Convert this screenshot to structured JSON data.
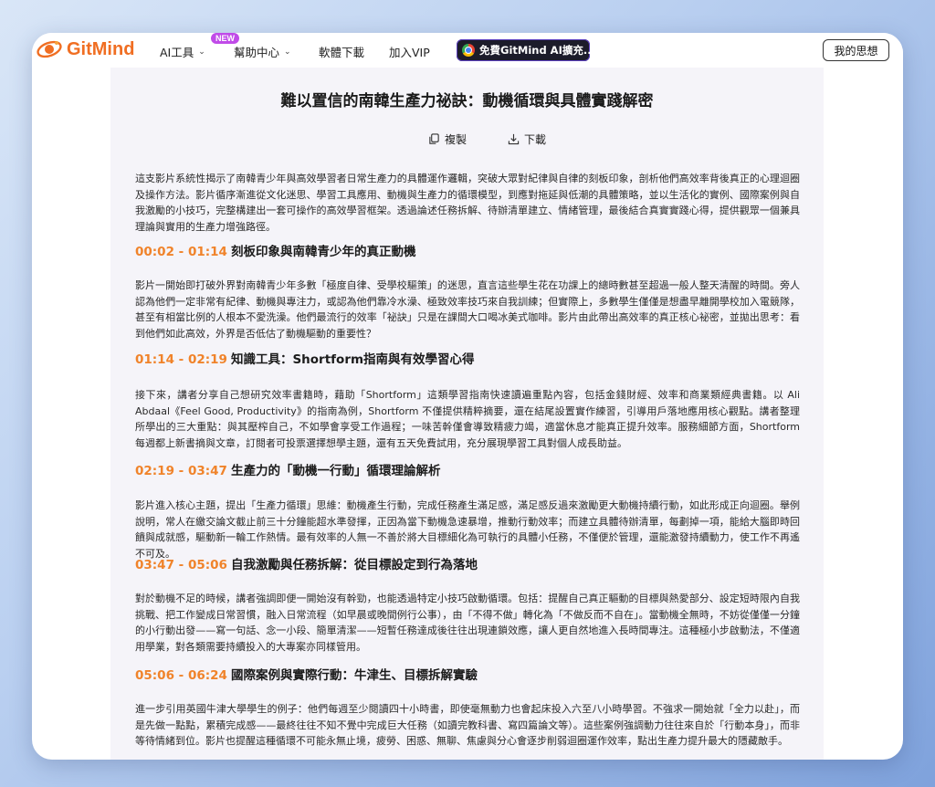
{
  "header": {
    "logo_text": "GitMind",
    "nav": [
      {
        "label": "AI工具"
      },
      {
        "label": "幫助中心"
      },
      {
        "label": "軟體下載"
      },
      {
        "label": "加入VIP"
      }
    ],
    "new_badge": "NEW",
    "promo_label": "免費GitMind AI擴充...",
    "my_ideas_label": "我的思想"
  },
  "article": {
    "title": "難以置信的南韓生產力祕訣：動機循環與具體實踐解密",
    "copy_label": "複製",
    "download_label": "下載",
    "intro": "這支影片系統性揭示了南韓青少年與高效學習者日常生產力的具體運作邏輯，突破大眾對紀律與自律的刻板印象，剖析他們高效率背後真正的心理迴圈及操作方法。影片循序漸進從文化迷思、學習工具應用、動機與生產力的循環模型，到應對拖延與低潮的具體策略，並以生活化的實例、國際案例與自我激勵的小技巧，完整構建出一套可操作的高效學習框架。透過論述任務拆解、待辦清單建立、情緒管理，最後結合真實實踐心得，提供觀眾一個兼具理論與實用的生產力增強路徑。",
    "sections": [
      {
        "time": "00:02 - 01:14",
        "heading": "刻板印象與南韓青少年的真正動機",
        "text": "影片一開始即打破外界對南韓青少年多數「極度自律、受學校驅策」的迷思，直言這些學生花在功課上的總時數甚至超過一般人整天清醒的時間。旁人認為他們一定非常有紀律、動機與專注力，或認為他們靠冷水澡、極致效率技巧來自我訓練；但實際上，多數學生僅僅是想盡早離開學校加入電競隊，甚至有相當比例的人根本不愛洗澡。他們最流行的效率「祕訣」只是在課間大口喝冰美式咖啡。影片由此帶出高效率的真正核心祕密，並拋出思考：看到他們如此高效，外界是否低估了動機驅動的重要性？"
      },
      {
        "time": "01:14 - 02:19",
        "heading": "知識工具：Shortform指南與有效學習心得",
        "text": "接下來，講者分享自己想研究效率書籍時，藉助「Shortform」這類學習指南快速讀遍重點內容，包括金錢財經、效率和商業類經典書籍。以 Ali Abdaal《Feel Good, Productivity》的指南為例，Shortform 不僅提供精粹摘要，還在結尾設置實作練習，引導用戶落地應用核心觀點。講者整理所學出的三大重點：與其壓榨自己，不如學會享受工作過程；一味苦幹僅會導致精疲力竭，適當休息才能真正提升效率。服務細節方面，Shortform 每週都上新書摘與文章，訂閱者可投票選擇想學主題，還有五天免費試用，充分展現學習工具對個人成長助益。"
      },
      {
        "time": "02:19 - 03:47",
        "heading": "生產力的「動機一行動」循環理論解析",
        "text": "影片進入核心主題，提出「生產力循環」思維：動機產生行動，完成任務產生滿足感，滿足感反過來激勵更大動機持續行動，如此形成正向迴圈。舉例說明，常人在繳交論文截止前三十分鐘能超水準發揮，正因為當下動機急速暴增，推動行動效率；而建立具體待辦清單，每劃掉一項，能給大腦即時回饋與成就感，驅動新一輪工作熱情。最有效率的人無一不善於將大目標細化為可執行的具體小任務，不僅便於管理，還能激發持續動力，使工作不再遙不可及。"
      },
      {
        "time": "03:47 - 05:06",
        "heading": "自我激勵與任務拆解：從目標設定到行為落地",
        "text": "對於動機不足的時候，講者強調即便一開始沒有幹勁，也能透過特定小技巧啟動循環。包括：提醒自己真正驅動的目標與熱愛部分、設定短時限內自我挑戰、把工作變成日常習慣，融入日常流程（如早晨或晚間例行公事），由「不得不做」轉化為「不做反而不自在」。當動機全無時，不妨從僅僅一分鐘的小行動出發——寫一句話、念一小段、簡單清潔——短暫任務達成後往往出現連鎖效應，讓人更自然地進入長時間專注。這種極小步啟動法，不僅適用學業，對各類需要持續投入的大專案亦同樣管用。"
      },
      {
        "time": "05:06 - 06:24",
        "heading": "國際案例與實際行動：牛津生、目標拆解實驗",
        "text": "進一步引用英國牛津大學學生的例子：他們每週至少閱讀四十小時書，即使毫無動力也會起床投入六至八小時學習。不強求一開始就「全力以赴」，而是先做一點點，累積完成感——最終往往不知不覺中完成巨大任務（如讀完教科書、寫四篇論文等）。這些案例強調動力往往來自於「行動本身」，而非等待情緒到位。影片也提醒這種循環不可能永無止境，疲勞、困惑、無聊、焦慮與分心會逐步削弱迴圈運作效率，點出生產力提升最大的隱藏敵手。"
      }
    ]
  },
  "colors": {
    "accent": "#f0832a",
    "brand": "#f06e22",
    "content_bg": "#f5f4f9"
  }
}
